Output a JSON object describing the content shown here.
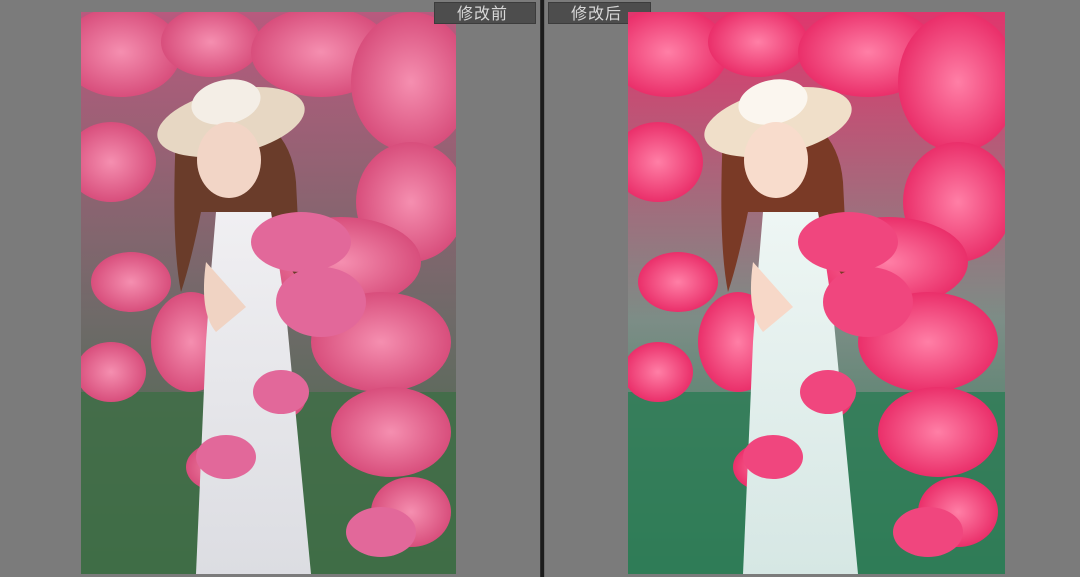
{
  "panels": {
    "before": {
      "label": "修改前"
    },
    "after": {
      "label": "修改后"
    }
  },
  "colors": {
    "background": "#7b7b7b",
    "label_bg": "#4d4d4d",
    "label_text": "#d8d8d8",
    "divider": "#1c1c1c"
  }
}
